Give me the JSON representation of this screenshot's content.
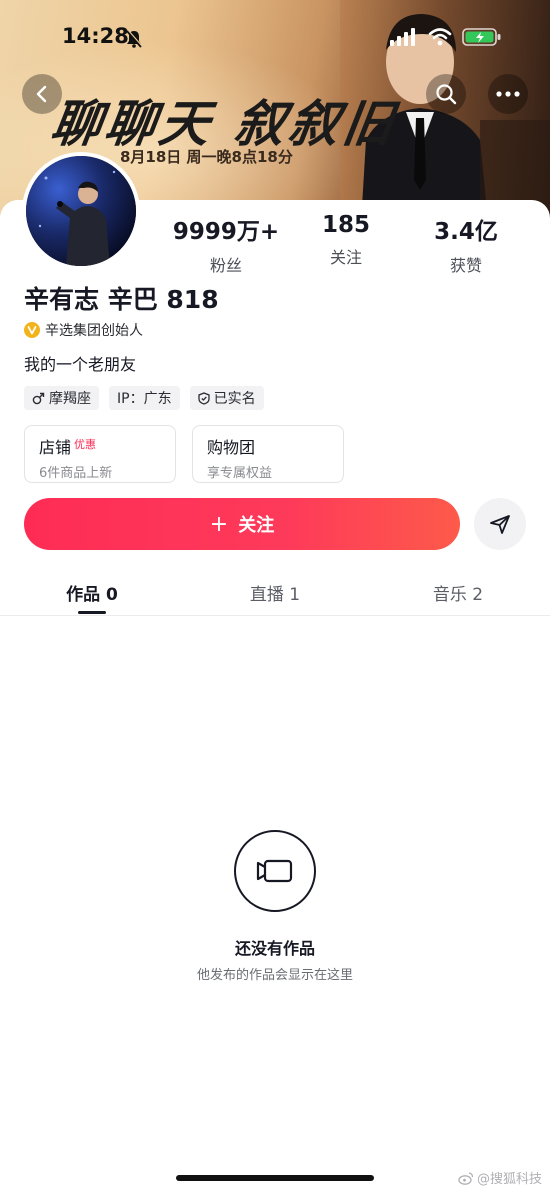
{
  "status_bar": {
    "time": "14:28"
  },
  "banner": {
    "title": "聊聊天 叙叙旧",
    "date": "8月18日 周一晚8点18分"
  },
  "stats": [
    {
      "value": "9999万+",
      "label": "粉丝"
    },
    {
      "value": "185",
      "label": "关注"
    },
    {
      "value": "3.4亿",
      "label": "获赞"
    }
  ],
  "profile": {
    "name": "辛有志 辛巴 818",
    "verification": "辛选集团创始人",
    "bio": "我的一个老朋友",
    "tags": [
      "摩羯座",
      "IP：广东",
      "已实名"
    ]
  },
  "shops": [
    {
      "title": "店铺",
      "badge": "优惠",
      "subtitle": "6件商品上新"
    },
    {
      "title": "购物团",
      "badge": "",
      "subtitle": "享专属权益"
    }
  ],
  "actions": {
    "follow_label": "关注"
  },
  "tabs": [
    {
      "label": "作品 0",
      "active": true
    },
    {
      "label": "直播 1",
      "active": false
    },
    {
      "label": "音乐 2",
      "active": false
    }
  ],
  "empty_state": {
    "title": "还没有作品",
    "subtitle": "他发布的作品会显示在这里"
  },
  "watermark": "@搜狐科技",
  "icons": {
    "back": "chevron-left-icon",
    "search": "search-icon",
    "more": "more-icon",
    "share": "paper-plane-icon",
    "empty": "video-camera-icon"
  },
  "colors": {
    "accent": "#fe2c55",
    "verify": "#f2b41c"
  }
}
